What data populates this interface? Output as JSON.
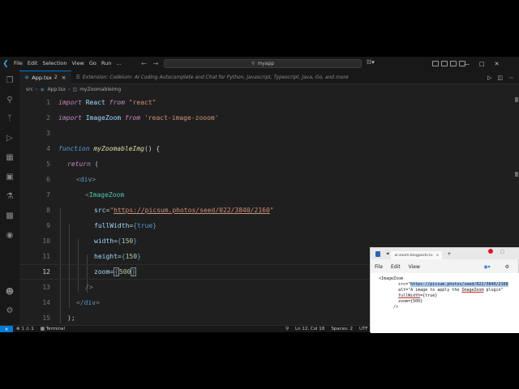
{
  "window": {
    "search_text": "myapp",
    "menu": [
      "File",
      "Edit",
      "Selection",
      "View",
      "Go",
      "Run",
      "…"
    ]
  },
  "tab": {
    "filename": "App.tsx",
    "modified_count": "2",
    "extension_info": "Extension: Codeium: AI Coding Autocomplete and Chat for Python, Javascript, Typescript, Java, Go, and more"
  },
  "breadcrumb": {
    "folder": "src",
    "file": "App.tsx",
    "symbol": "myZoomableImg"
  },
  "editor": {
    "line_numbers": [
      "1",
      "2",
      "3",
      "4",
      "5",
      "6",
      "7",
      "8",
      "9",
      "10",
      "11",
      "12",
      "13",
      "14",
      "15"
    ],
    "current_line": "12",
    "l1": {
      "kw": "import",
      "name": "React",
      "from": "from",
      "str": "\"react\""
    },
    "l2": {
      "kw": "import",
      "name": "ImageZoom",
      "from": "from",
      "str": "'react-image-zooom'"
    },
    "l4": {
      "kw": "function",
      "name": "myZoomableImg",
      "rest": "() {"
    },
    "l5": {
      "kw": "return",
      "rest": "("
    },
    "l6": {
      "open": "<",
      "tag": "div",
      "close": ">"
    },
    "l7": {
      "open": "<",
      "tag": "ImageZoom"
    },
    "l8": {
      "attr": "src",
      "eq": "=",
      "q1": "\"",
      "url": "https://picsum.photos/seed/022/3840/2160",
      "q2": "\""
    },
    "l9": {
      "attr": "fullWidth",
      "eq": "=",
      "ob": "{",
      "val": "true",
      "cb": "}"
    },
    "l10": {
      "attr": "width",
      "eq": "=",
      "ob": "{",
      "val": "150",
      "cb": "}"
    },
    "l11": {
      "attr": "height",
      "eq": "=",
      "ob": "{",
      "val": "150",
      "cb": "}"
    },
    "l12": {
      "attr": "zoom",
      "eq": "=",
      "ob": "{",
      "val": "500",
      "cb": "}"
    },
    "l13": {
      "text": "/>"
    },
    "l14": {
      "open": "</",
      "tag": "div",
      "close": ">"
    },
    "l15": {
      "text": ");"
    }
  },
  "status": {
    "errors": "⊗ 1",
    "warnings": "⚠ 1",
    "terminal": "Terminal",
    "position": "Ln 12, Col 18",
    "spaces": "Spaces: 2",
    "encoding": "UTF"
  },
  "notepad": {
    "tab_name": "ai-zoom-blogposts.tx",
    "menu": [
      "File",
      "Edit",
      "View"
    ],
    "lines": {
      "l1": "<ImageZoom",
      "l2_prefix": "        src=\"",
      "l2_sel": "https://picsum.photos/seed/022/3840/2160",
      "l3_prefix": "        alt=\"A image to apply the ",
      "l3_ul": "ImageZoom",
      "l3_suffix": " plugin\"",
      "l4_ul": "fullWidth",
      "l4_suffix": "={true}",
      "l5": "        zoom={500}",
      "l6": "      />"
    }
  }
}
